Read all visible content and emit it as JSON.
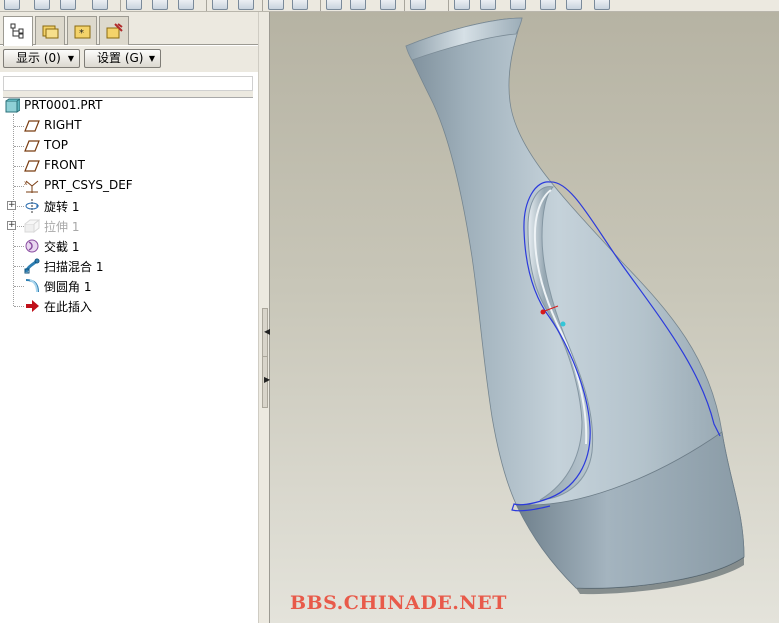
{
  "toolbar": {
    "icons": [
      "new-icon",
      "open-icon",
      "save-icon",
      "print-icon",
      "undo-icon",
      "redo-icon",
      "regenerate-icon",
      "copy-icon",
      "paste-icon",
      "find-icon",
      "select-box-icon",
      "repaint-icon",
      "spin-center-icon",
      "orient-icon",
      "zoom-in-icon",
      "zoom-out-icon",
      "refit-icon",
      "reorient-icon",
      "saved-views-icon",
      "layers-icon",
      "display-style-icon"
    ]
  },
  "navigator": {
    "tabs": [
      {
        "name": "model-tree-tab",
        "icon": "model-tree-icon",
        "active": true
      },
      {
        "name": "folder-browser-tab",
        "icon": "folder-icon",
        "active": false
      },
      {
        "name": "favorites-tab",
        "icon": "favorites-icon",
        "active": false
      },
      {
        "name": "connections-tab",
        "icon": "connections-icon",
        "active": false
      }
    ],
    "show_label": "显示 (0)",
    "settings_label": "设置 (G)"
  },
  "tree": {
    "root": "PRT0001.PRT",
    "items": [
      {
        "label": "RIGHT",
        "icon": "datum-plane-icon",
        "expandable": false,
        "suppressed": false
      },
      {
        "label": "TOP",
        "icon": "datum-plane-icon",
        "expandable": false,
        "suppressed": false
      },
      {
        "label": "FRONT",
        "icon": "datum-plane-icon",
        "expandable": false,
        "suppressed": false
      },
      {
        "label": "PRT_CSYS_DEF",
        "icon": "coordinate-system-icon",
        "expandable": false,
        "suppressed": false
      },
      {
        "label": "旋转 1",
        "icon": "revolve-icon",
        "expandable": true,
        "suppressed": false
      },
      {
        "label": "拉伸 1",
        "icon": "extrude-icon",
        "expandable": true,
        "suppressed": true
      },
      {
        "label": "交截 1",
        "icon": "intersect-icon",
        "expandable": false,
        "suppressed": false
      },
      {
        "label": "扫描混合 1",
        "icon": "swept-blend-icon",
        "expandable": false,
        "suppressed": false
      },
      {
        "label": "倒圆角 1",
        "icon": "round-icon",
        "expandable": false,
        "suppressed": false
      },
      {
        "label": "在此插入",
        "icon": "insert-here-arrow-icon",
        "expandable": false,
        "suppressed": false
      }
    ]
  },
  "viewport": {
    "watermark": "BBS.CHINADE.NET"
  },
  "colors": {
    "panel_bg": "#ece9e0",
    "model_surface": "#a9b8c2",
    "curve_blue": "#2b3adc",
    "point_red": "#d81a1a",
    "watermark_red": "#e85a4a",
    "insert_arrow": "#c0101a"
  }
}
